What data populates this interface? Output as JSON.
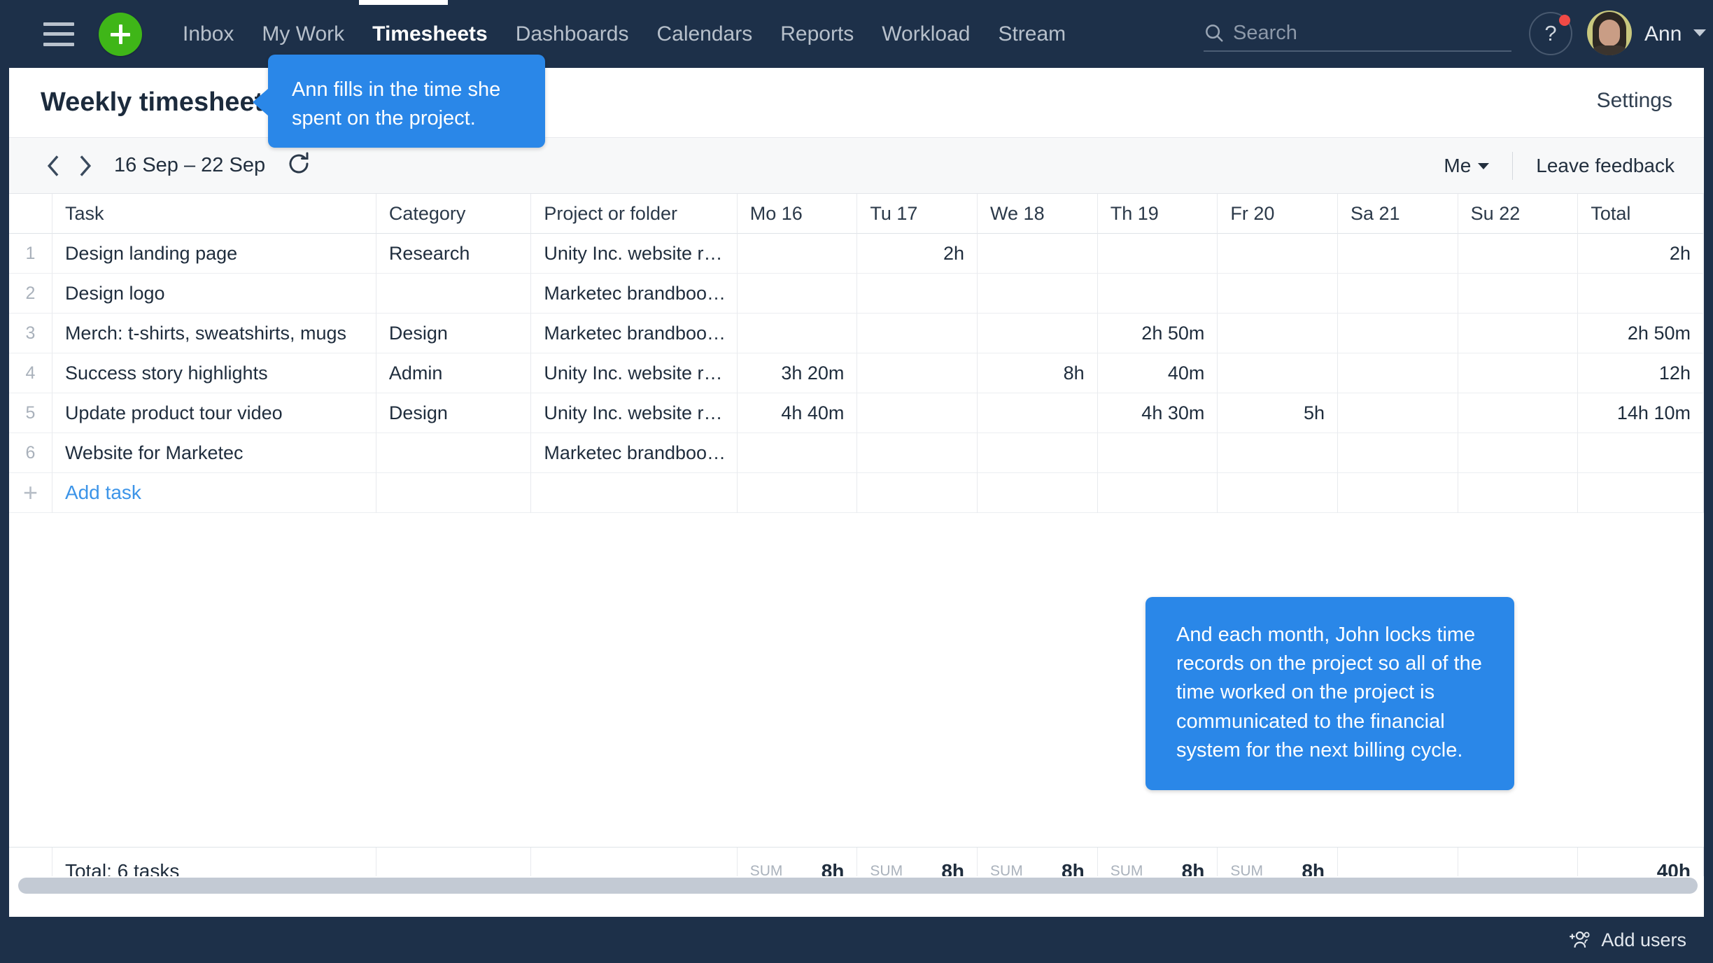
{
  "navbar": {
    "menu_icon": "hamburger-icon",
    "create_icon": "plus-icon",
    "links": [
      {
        "label": "Inbox",
        "active": false
      },
      {
        "label": "My Work",
        "active": false
      },
      {
        "label": "Timesheets",
        "active": true
      },
      {
        "label": "Dashboards",
        "active": false
      },
      {
        "label": "Calendars",
        "active": false
      },
      {
        "label": "Reports",
        "active": false
      },
      {
        "label": "Workload",
        "active": false
      },
      {
        "label": "Stream",
        "active": false
      }
    ],
    "search": {
      "placeholder": "Search",
      "value": "",
      "icon": "search-icon"
    },
    "help": {
      "label": "?",
      "has_notification": true
    },
    "user": {
      "name": "Ann",
      "avatar": "user-avatar"
    },
    "colors": {
      "bar": "#1d3049",
      "accent_green": "#3fb618",
      "notification": "#f04a46"
    }
  },
  "page": {
    "title": "Weekly timesheet",
    "settings_label": "Settings"
  },
  "toolbar": {
    "prev_icon": "chevron-left-icon",
    "next_icon": "chevron-right-icon",
    "date_range": "16 Sep – 22 Sep",
    "refresh_icon": "refresh-icon",
    "filter_label": "Me",
    "feedback_label": "Leave feedback"
  },
  "table": {
    "columns": [
      "Task",
      "Category",
      "Project or folder",
      "Mo 16",
      "Tu 17",
      "We 18",
      "Th 19",
      "Fr 20",
      "Sa 21",
      "Su 22",
      "Total"
    ],
    "rows": [
      {
        "num": "1",
        "task": "Design landing page",
        "category": "Research",
        "project": "Unity Inc. website r…",
        "days": [
          "",
          "2h",
          "",
          "",
          "",
          "",
          ""
        ],
        "marks": [
          false,
          true,
          false,
          false,
          false,
          false,
          false
        ],
        "total": "2h"
      },
      {
        "num": "2",
        "task": "Design logo",
        "category": "",
        "project": "Marketec brandboo…",
        "days": [
          "",
          "",
          "",
          "",
          "",
          "",
          ""
        ],
        "marks": [
          false,
          false,
          false,
          false,
          false,
          false,
          false
        ],
        "total": ""
      },
      {
        "num": "3",
        "task": "Merch: t-shirts, sweatshirts, mugs",
        "category": "Design",
        "project": "Marketec brandboo…",
        "days": [
          "",
          "",
          "",
          "2h 50m",
          "",
          "",
          ""
        ],
        "marks": [
          false,
          false,
          false,
          false,
          false,
          false,
          false
        ],
        "total": "2h 50m"
      },
      {
        "num": "4",
        "task": "Success story highlights",
        "category": "Admin",
        "project": "Unity Inc. website r…",
        "days": [
          "3h 20m",
          "",
          "8h",
          "40m",
          "",
          "",
          ""
        ],
        "marks": [
          true,
          false,
          false,
          false,
          false,
          false,
          false
        ],
        "total": "12h"
      },
      {
        "num": "5",
        "task": "Update product tour video",
        "category": "Design",
        "project": "Unity Inc. website r…",
        "days": [
          "4h 40m",
          "",
          "",
          "4h 30m",
          "5h",
          "",
          ""
        ],
        "marks": [
          false,
          false,
          false,
          false,
          false,
          false,
          false
        ],
        "total": "14h 10m"
      },
      {
        "num": "6",
        "task": "Website for Marketec",
        "category": "",
        "project": "Marketec brandboo…",
        "days": [
          "",
          "",
          "",
          "",
          "",
          "",
          ""
        ],
        "marks": [
          false,
          false,
          false,
          false,
          false,
          false,
          false
        ],
        "total": ""
      }
    ],
    "add_row": {
      "icon": "plus-icon",
      "label": "Add task"
    },
    "footer": {
      "total_label": "Total: 6 tasks",
      "sum_label": "SUM",
      "day_sums": [
        "8h",
        "8h",
        "8h",
        "8h",
        "8h",
        "",
        ""
      ],
      "grand_total": "40h"
    }
  },
  "callouts": [
    {
      "id": "callout-timesheet",
      "text": "Ann fills in the time she spent on the project."
    },
    {
      "id": "callout-lock",
      "text": "And each month, John locks time records on the project so all of the time worked on the project is communicated to the financial system for the next billing cycle."
    }
  ],
  "bottombar": {
    "add_users_label": "Add users",
    "add_users_icon": "add-users-icon"
  }
}
